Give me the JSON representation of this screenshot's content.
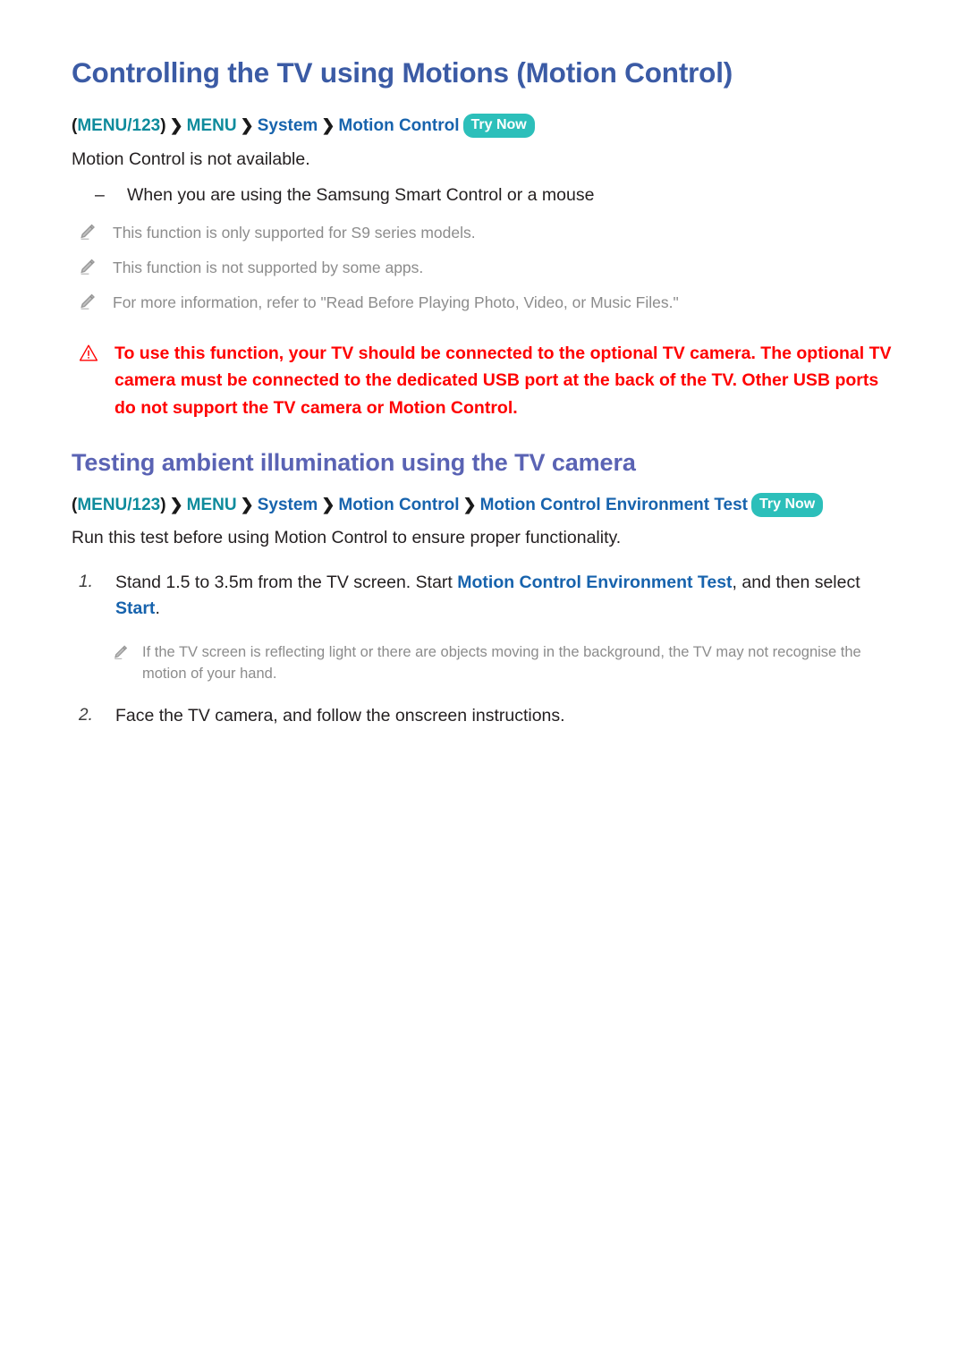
{
  "section1": {
    "title": "Controlling the TV using Motions (Motion Control)",
    "breadcrumb": {
      "open_paren": "(",
      "menu123": "MENU/123",
      "close_paren": ")",
      "chevron": "❯",
      "menu": "MENU",
      "system": "System",
      "motion_control": "Motion Control",
      "try_now": "Try Now"
    },
    "intro": "Motion Control is not available.",
    "dash_item": {
      "marker": "–",
      "text": "When you are using the Samsung Smart Control or a mouse"
    },
    "notes": [
      "This function is only supported for S9 series models.",
      "This function is not supported by some apps.",
      "For more information, refer to \"Read Before Playing Photo, Video, or Music Files.\""
    ],
    "warning": "To use this function, your TV should be connected to the optional TV camera. The optional TV camera must be connected to the dedicated USB port at the back of the TV. Other USB ports do not support the TV camera or Motion Control."
  },
  "section2": {
    "title": "Testing ambient illumination using the TV camera",
    "breadcrumb": {
      "open_paren": "(",
      "menu123": "MENU/123",
      "close_paren": ")",
      "chevron": "❯",
      "menu": "MENU",
      "system": "System",
      "motion_control": "Motion Control",
      "environment_test": "Motion Control Environment Test",
      "try_now": "Try Now"
    },
    "intro": "Run this test before using Motion Control to ensure proper functionality.",
    "steps": [
      {
        "number": "1.",
        "text_before": "Stand 1.5 to 3.5m from the TV screen. Start ",
        "link1": "Motion Control Environment Test",
        "text_middle": ", and then select ",
        "link2": "Start",
        "text_after": "."
      },
      {
        "number": "2.",
        "text_before": "Face the TV camera, and follow the onscreen instructions.",
        "link1": "",
        "text_middle": "",
        "link2": "",
        "text_after": ""
      }
    ],
    "step_note": "If the TV screen is reflecting light or there are objects moving in the background, the TV may not recognise the motion of your hand."
  },
  "icons": {
    "pencil": "pencil-icon",
    "warning": "warning-triangle-icon"
  },
  "colors": {
    "title_blue": "#3b5ba5",
    "subtitle_blue": "#5a63b4",
    "teal": "#0e8b9c",
    "link_blue": "#1763ad",
    "badge_teal": "#2cbfba",
    "warning_red": "#ff0000",
    "note_gray": "#8c8c8c",
    "body_text": "#231f20"
  }
}
